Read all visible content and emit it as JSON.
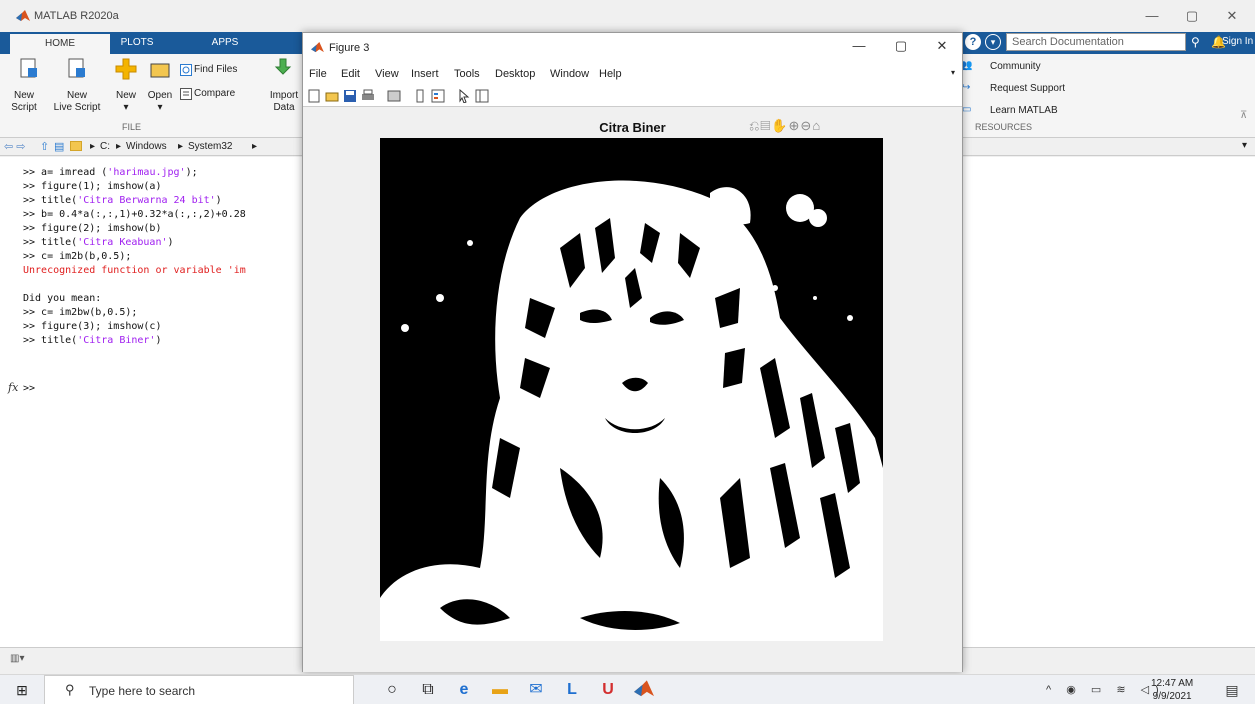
{
  "app": {
    "title": "MATLAB R2020a",
    "win_min": "—",
    "win_max": "▢",
    "win_close": "✕"
  },
  "tabs": [
    {
      "label": "HOME"
    },
    {
      "label": "PLOTS"
    },
    {
      "label": "APPS"
    }
  ],
  "search": {
    "placeholder": "Search Documentation"
  },
  "signin": "Sign In",
  "ribbon": {
    "new_script": [
      "New",
      "Script"
    ],
    "new_live": [
      "New",
      "Live Script"
    ],
    "new": "New",
    "open": "Open",
    "find_files": "Find Files",
    "compare": "Compare",
    "import": [
      "Import",
      "Data"
    ],
    "file_group": "FILE",
    "community": "Community",
    "request_support": "Request Support",
    "learn_matlab": "Learn MATLAB",
    "resources_group": "RESOURCES"
  },
  "path": [
    "C:",
    "Windows",
    "System32"
  ],
  "command_lines": [
    {
      "pre": ">> a= imread (",
      "str": "'harimau.jpg'",
      "post": ");"
    },
    {
      "pre": ">> figure(1); imshow(a)",
      "str": "",
      "post": ""
    },
    {
      "pre": ">> title(",
      "str": "'Citra Berwarna 24 bit'",
      "post": ")"
    },
    {
      "pre": ">> b= 0.4*a(:,:,1)+0.32*a(:,:,2)+0.28",
      "str": "",
      "post": ""
    },
    {
      "pre": ">> figure(2); imshow(b)",
      "str": "",
      "post": ""
    },
    {
      "pre": ">> title(",
      "str": "'Citra Keabuan'",
      "post": ")"
    },
    {
      "pre": ">> c= im2b(b,0.5);",
      "str": "",
      "post": ""
    }
  ],
  "error_line": "Unrecognized function or variable 'im",
  "did_you_mean": "Did you mean:",
  "command_lines2": [
    {
      "pre": ">> c= im2bw(b,0.5);",
      "str": "",
      "post": ""
    },
    {
      "pre": ">> figure(3); imshow(c)",
      "str": "",
      "post": ""
    },
    {
      "pre": ">> title(",
      "str": "'Citra Biner'",
      "post": ")"
    }
  ],
  "prompt": ">>",
  "fx": "fx",
  "figure": {
    "title": "Figure 3",
    "menus": [
      "File",
      "Edit",
      "View",
      "Insert",
      "Tools",
      "Desktop",
      "Window",
      "Help"
    ],
    "plot_title": "Citra Biner"
  },
  "taskbar": {
    "search_placeholder": "Type here to search",
    "time": "12:47 AM",
    "date": "9/9/2021"
  }
}
